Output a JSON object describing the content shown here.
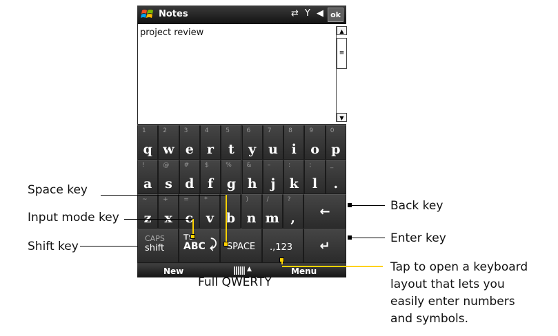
{
  "titlebar": {
    "app": "Notes",
    "ok": "ok",
    "icons": [
      "windows-logo",
      "connectivity-arrows",
      "signal-antenna",
      "speaker"
    ]
  },
  "document": {
    "text": "project review"
  },
  "keyboard": {
    "row1": [
      {
        "n": "1",
        "k": "q"
      },
      {
        "n": "2",
        "k": "w"
      },
      {
        "n": "3",
        "k": "e"
      },
      {
        "n": "4",
        "k": "r"
      },
      {
        "n": "5",
        "k": "t"
      },
      {
        "n": "6",
        "k": "y"
      },
      {
        "n": "7",
        "k": "u"
      },
      {
        "n": "8",
        "k": "i"
      },
      {
        "n": "9",
        "k": "o"
      },
      {
        "n": "0",
        "k": "p"
      }
    ],
    "row2": [
      {
        "n": "!",
        "k": "a"
      },
      {
        "n": "@",
        "k": "s"
      },
      {
        "n": "#",
        "k": "d"
      },
      {
        "n": "$",
        "k": "f"
      },
      {
        "n": "%",
        "k": "g"
      },
      {
        "n": "&",
        "k": "h"
      },
      {
        "n": "–",
        "k": "j"
      },
      {
        "n": ":",
        "k": "k"
      },
      {
        "n": ";",
        "k": "l"
      },
      {
        "n": "_",
        "k": "."
      }
    ],
    "row3": [
      {
        "n": "~",
        "k": "z"
      },
      {
        "n": "+",
        "k": "x"
      },
      {
        "n": "=",
        "k": "c"
      },
      {
        "n": "*",
        "k": "v"
      },
      {
        "n": "(",
        "k": "b"
      },
      {
        "n": ")",
        "k": "n"
      },
      {
        "n": "/",
        "k": "m"
      },
      {
        "n": "?",
        "k": ","
      }
    ],
    "caps": "CAPS",
    "shift": "shift",
    "t9": "T9",
    "abc": "ABC",
    "space": "SPACE",
    "num": ".,123"
  },
  "menubar": {
    "left": "New",
    "right": "Menu"
  },
  "annotations": {
    "space_key": "Space key",
    "input_mode_key": "Input mode key",
    "shift_key": "Shift key",
    "back_key": "Back key",
    "enter_key": "Enter key",
    "tap_note": [
      "Tap to open a keyboard",
      "layout that lets you",
      "easily enter numbers",
      "and symbols."
    ],
    "caption": "Full QWERTY"
  },
  "colors": {
    "highlight": "#ffd200",
    "keyboard_bg": "#3a3a3a"
  }
}
